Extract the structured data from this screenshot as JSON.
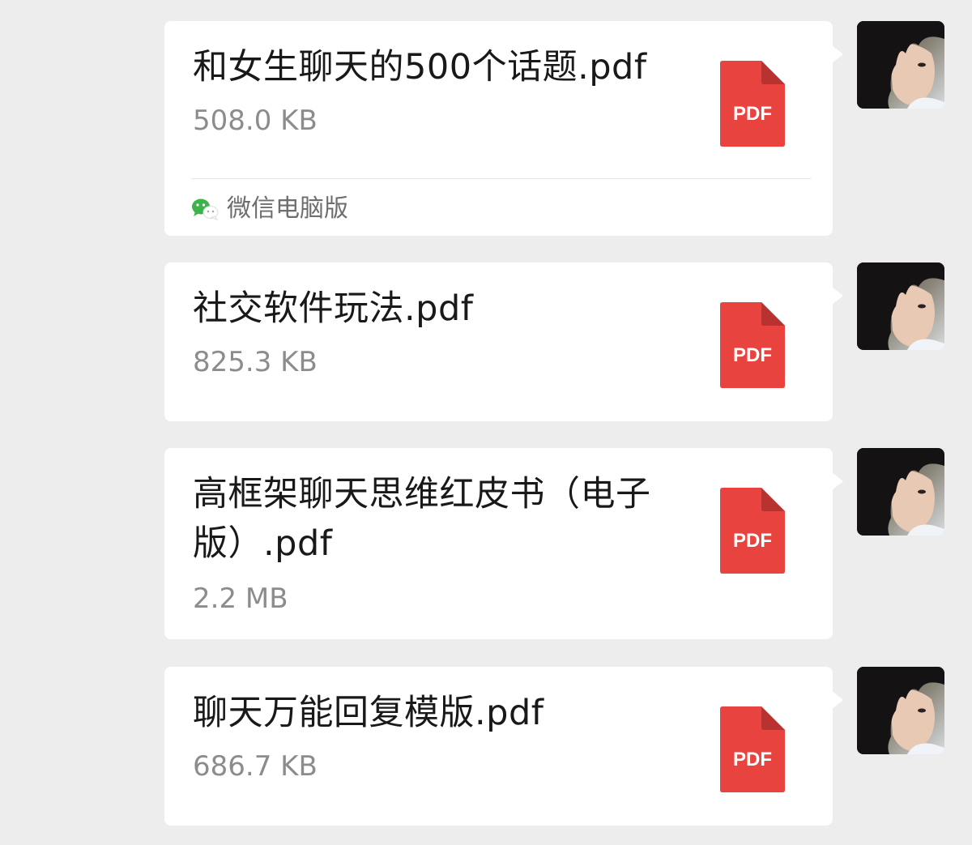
{
  "colors": {
    "background": "#ededed",
    "bubble": "#ffffff",
    "file_name": "#191919",
    "file_size": "#8c8c8c",
    "pdf_red": "#e94340",
    "pdf_fold": "#b8322f",
    "wechat_green": "#3eb34b"
  },
  "messages": [
    {
      "file_name": "和女生聊天的500个话题.pdf",
      "file_size": "508.0 KB",
      "icon": "pdf-file-icon",
      "icon_label": "PDF",
      "source": "微信电脑版",
      "source_icon": "wechat-icon"
    },
    {
      "file_name": "社交软件玩法.pdf",
      "file_size": "825.3 KB",
      "icon": "pdf-file-icon",
      "icon_label": "PDF"
    },
    {
      "file_name": "高框架聊天思维红皮书（电子版）.pdf",
      "file_size": "2.2 MB",
      "icon": "pdf-file-icon",
      "icon_label": "PDF"
    },
    {
      "file_name": "聊天万能回复模版.pdf",
      "file_size": "686.7 KB",
      "icon": "pdf-file-icon",
      "icon_label": "PDF"
    }
  ]
}
